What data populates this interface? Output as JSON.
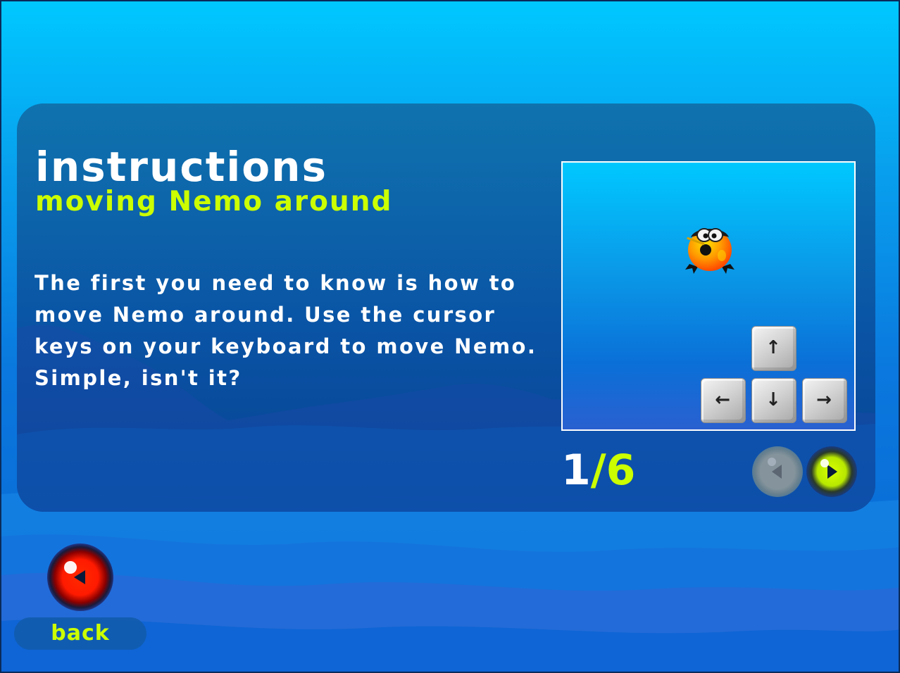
{
  "screen": {
    "title": "instructions",
    "subtitle": "moving Nemo around",
    "body": "The first you need to know is how to move Nemo around. Use the cursor keys on your keyboard to move Nemo. Simple, isn't it?"
  },
  "preview": {
    "character_icon": "nemo-fish-icon",
    "keys": {
      "up": "↑",
      "left": "←",
      "down": "↓",
      "right": "→"
    }
  },
  "pagination": {
    "current": "1",
    "separator": "/",
    "total": "6",
    "prev_icon": "play-left-icon",
    "next_icon": "play-right-icon",
    "prev_enabled": false,
    "next_enabled": true
  },
  "back": {
    "label": "back",
    "icon": "play-left-icon"
  },
  "colors": {
    "accent": "#ccff00",
    "text": "#ffffff",
    "sky_top": "#00c8ff",
    "sea": "#0a66d2"
  }
}
